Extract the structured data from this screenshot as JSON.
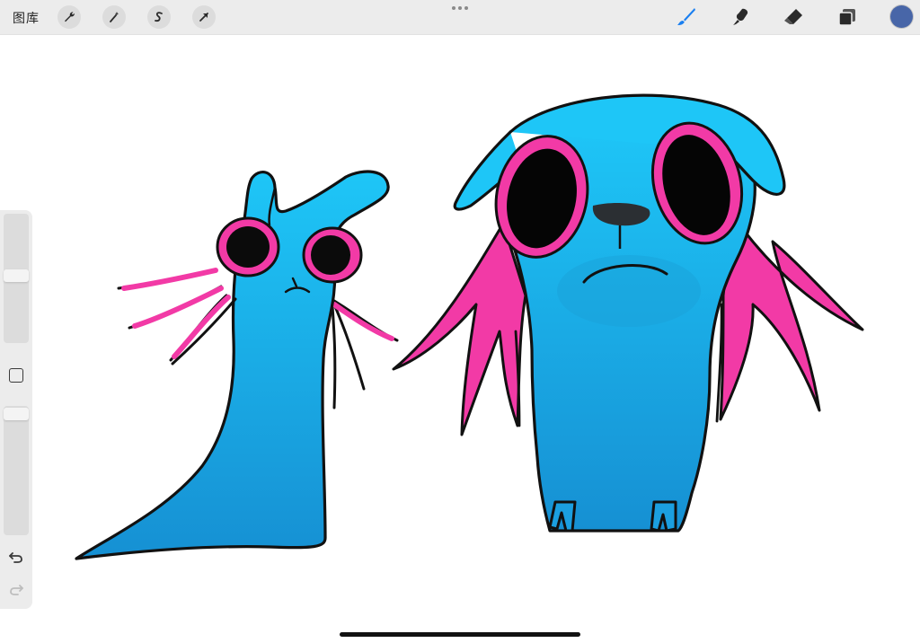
{
  "toolbar": {
    "gallery_label": "图库",
    "left_tools": [
      {
        "name": "actions",
        "icon": "wrench-icon"
      },
      {
        "name": "adjustments",
        "icon": "magic-wand-icon"
      },
      {
        "name": "selection",
        "icon": "selection-s-icon"
      },
      {
        "name": "transform",
        "icon": "arrow-cursor-icon"
      }
    ],
    "more_icon": "more-dots-icon",
    "right_tools": [
      {
        "name": "brush",
        "icon": "brush-icon",
        "active": true,
        "color": "#1a7ff0"
      },
      {
        "name": "smudge",
        "icon": "smudge-icon"
      },
      {
        "name": "eraser",
        "icon": "eraser-icon"
      },
      {
        "name": "layers",
        "icon": "layers-icon"
      }
    ],
    "current_color": "#4866a8"
  },
  "sidebar": {
    "brush_size_level": 0.56,
    "opacity_level": 0.02,
    "modify_icon": "square-modify-icon",
    "undo_icon": "undo-icon",
    "redo_icon": "redo-icon"
  },
  "canvas": {
    "background": "#ffffff",
    "colors": {
      "creature_blue": "#1cb8f2",
      "creature_blue_dark": "#1596d6",
      "hair_pink": "#f23aa6",
      "outline": "#111111"
    }
  }
}
